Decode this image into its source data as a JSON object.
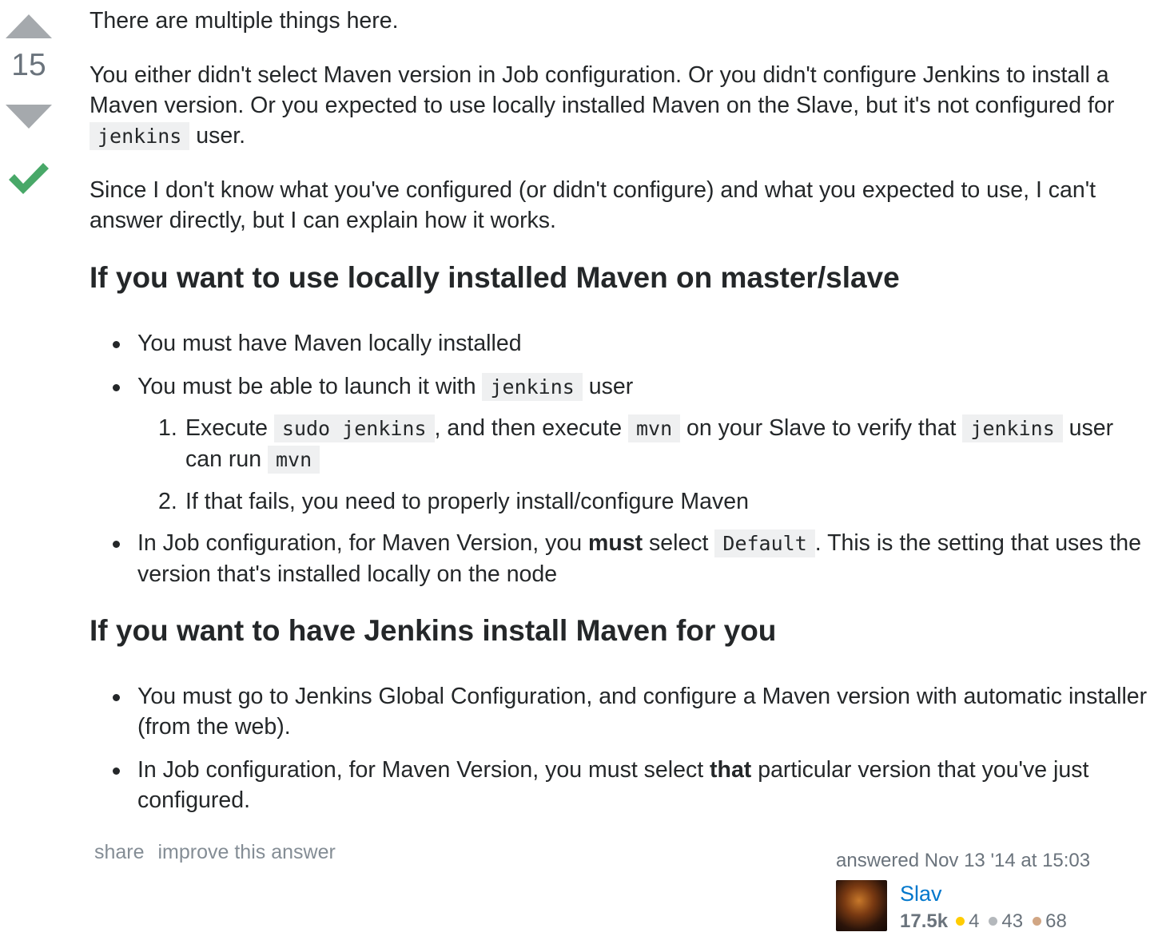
{
  "vote": {
    "count": "15"
  },
  "post": {
    "p1": "There are multiple things here.",
    "p2": {
      "text_a": "You either didn't select Maven version in Job configuration. Or you didn't configure Jenkins to install a Maven version. Or you expected to use locally installed Maven on the Slave, but it's not configured for ",
      "code": "jenkins",
      "text_b": " user."
    },
    "p3": "Since I don't know what you've configured (or didn't configure) and what you expected to use, I can't answer directly, but I can explain how it works.",
    "section_a": {
      "heading": "If you want to use locally installed Maven on master/slave",
      "item1": "You must have Maven locally installed",
      "item2": {
        "text_a": "You must be able to launch it with ",
        "code": "jenkins",
        "text_b": " user"
      },
      "sub1": {
        "num": "1.",
        "text_a": "Execute ",
        "code1": "sudo jenkins",
        "text_b": ", and then execute ",
        "code2": "mvn",
        "text_c": " on your Slave to verify that ",
        "code3": "jenkins",
        "text_d": " user can run ",
        "code4": "mvn"
      },
      "sub2": {
        "num": "2.",
        "text": "If that fails, you need to properly install/configure Maven"
      },
      "item3": {
        "text_a": "In Job configuration, for Maven Version, you ",
        "bold": "must",
        "text_b": " select ",
        "code": "Default",
        "text_c": ". This is the setting that uses the version that's installed locally on the node"
      }
    },
    "section_b": {
      "heading": "If you want to have Jenkins install Maven for you",
      "item1": "You must go to Jenkins Global Configuration, and configure a Maven version with automatic installer (from the web).",
      "item2": {
        "text_a": "In Job configuration, for Maven Version, you must select ",
        "bold": "that",
        "text_b": " particular version that you've just configured."
      }
    }
  },
  "footer": {
    "share": "share",
    "improve": "improve this answer",
    "answered": "answered Nov 13 '14 at 15:03",
    "user_name": "Slav",
    "reputation": "17.5k",
    "gold": "4",
    "silver": "43",
    "bronze": "68"
  },
  "colors": {
    "accepted": "#48a868",
    "vote_arrow": "#a5a9ad",
    "link": "#0077cc",
    "code_bg": "#eff0f1"
  }
}
